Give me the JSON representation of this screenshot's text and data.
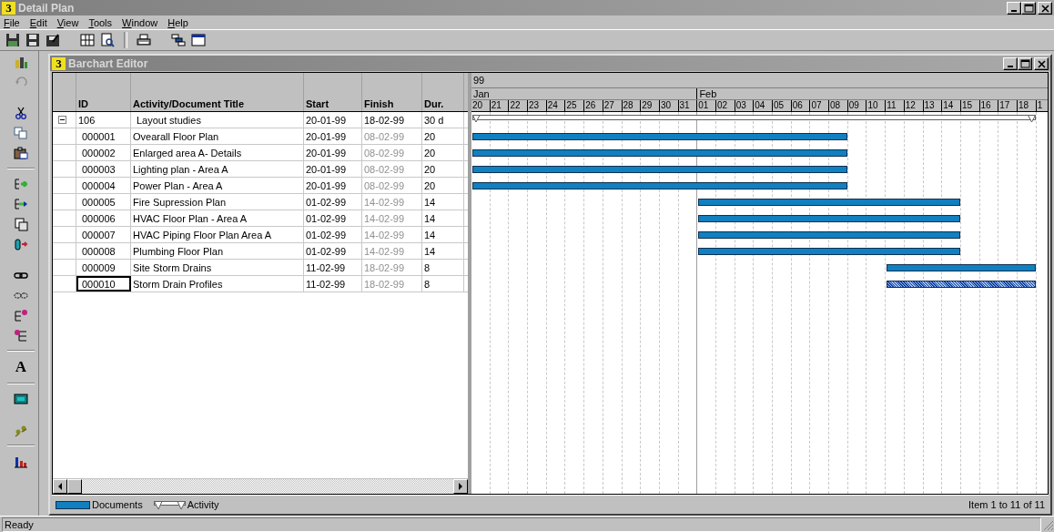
{
  "window": {
    "logo": "3",
    "title": "Detail Plan"
  },
  "menu": [
    "File",
    "Edit",
    "View",
    "Tools",
    "Window",
    "Help"
  ],
  "side_toolbar": {
    "font_button": "A"
  },
  "editor": {
    "logo": "3",
    "title": "Barchart Editor",
    "columns": [
      "ID",
      "Activity/Document Title",
      "Start",
      "Finish",
      "Dur."
    ],
    "timeline": {
      "year": "99",
      "months": [
        {
          "name": "Jan",
          "days": [
            "20",
            "21",
            "22",
            "23",
            "24",
            "25",
            "26",
            "27",
            "28",
            "29",
            "30",
            "31"
          ]
        },
        {
          "name": "Feb",
          "days": [
            "01",
            "02",
            "03",
            "04",
            "05",
            "06",
            "07",
            "08",
            "09",
            "10",
            "11",
            "12",
            "13",
            "14",
            "15",
            "16",
            "17",
            "18",
            "1"
          ]
        }
      ]
    },
    "rows": [
      {
        "id": "106",
        "title": "Layout studies",
        "start": "20-01-99",
        "finish": "18-02-99",
        "duration": "30 d",
        "expanded": true,
        "children": [
          {
            "id": "000001",
            "title": "Ovearall Floor Plan",
            "start": "20-01-99",
            "finish": "08-02-99",
            "duration": "20",
            "finish_dimmed": true,
            "selected": false
          },
          {
            "id": "000002",
            "title": "Enlarged area A- Details",
            "start": "20-01-99",
            "finish": "08-02-99",
            "duration": "20",
            "finish_dimmed": true,
            "selected": false
          },
          {
            "id": "000003",
            "title": "Lighting plan  - Area A",
            "start": "20-01-99",
            "finish": "08-02-99",
            "duration": "20",
            "finish_dimmed": true,
            "selected": false
          },
          {
            "id": "000004",
            "title": "Power Plan - Area A",
            "start": "20-01-99",
            "finish": "08-02-99",
            "duration": "20",
            "finish_dimmed": true,
            "selected": false
          },
          {
            "id": "000005",
            "title": "Fire Supression Plan",
            "start": "01-02-99",
            "finish": "14-02-99",
            "duration": "14",
            "finish_dimmed": true,
            "selected": false
          },
          {
            "id": "000006",
            "title": "HVAC Floor Plan - Area A",
            "start": "01-02-99",
            "finish": "14-02-99",
            "duration": "14",
            "finish_dimmed": true,
            "selected": false
          },
          {
            "id": "000007",
            "title": "HVAC Piping Floor Plan Area A",
            "start": "01-02-99",
            "finish": "14-02-99",
            "duration": "14",
            "finish_dimmed": true,
            "selected": false
          },
          {
            "id": "000008",
            "title": "Plumbing Floor Plan",
            "start": "01-02-99",
            "finish": "14-02-99",
            "duration": "14",
            "finish_dimmed": true,
            "selected": false
          },
          {
            "id": "000009",
            "title": "Site Storm Drains",
            "start": "11-02-99",
            "finish": "18-02-99",
            "duration": "8",
            "finish_dimmed": true,
            "selected": false
          },
          {
            "id": "000010",
            "title": "Storm Drain Profiles",
            "start": "11-02-99",
            "finish": "18-02-99",
            "duration": "8",
            "finish_dimmed": true,
            "selected": true
          }
        ]
      }
    ],
    "legend": [
      {
        "kind": "document",
        "label": "Documents"
      },
      {
        "kind": "activity",
        "label": "Activity"
      }
    ],
    "item_count": "Item 1 to 11 of 11"
  },
  "status_bar": {
    "text": "Ready"
  }
}
